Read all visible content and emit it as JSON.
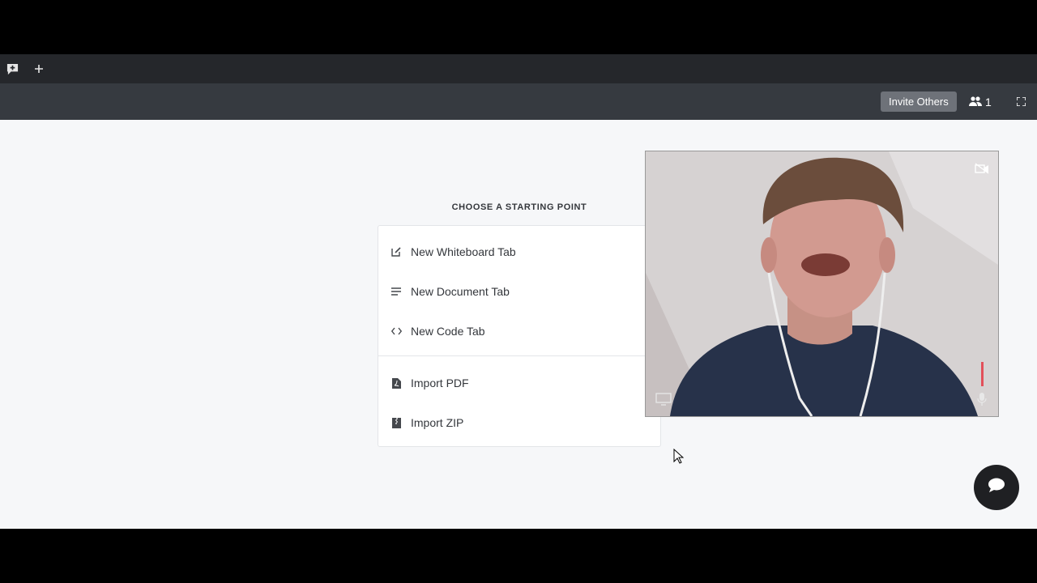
{
  "tabbar": {
    "icons": [
      "new-tab-chat-icon",
      "plus-icon"
    ]
  },
  "toolbar": {
    "invite_label": "Invite Others",
    "participant_count": "1"
  },
  "main": {
    "heading": "CHOOSE A STARTING POINT",
    "options": [
      {
        "label": "New Whiteboard Tab",
        "icon": "edit-icon"
      },
      {
        "label": "New Document Tab",
        "icon": "lines-icon"
      },
      {
        "label": "New Code Tab",
        "icon": "code-icon"
      },
      {
        "label": "Import PDF",
        "icon": "pdf-file-icon"
      },
      {
        "label": "Import ZIP",
        "icon": "zip-file-icon"
      }
    ]
  },
  "colors": {
    "tabbar_bg": "#25272b",
    "toolbar_bg": "#363a40",
    "invite_button_bg": "#6e7279",
    "page_bg": "#f6f7f9",
    "chat_button_bg": "#1f2023"
  }
}
